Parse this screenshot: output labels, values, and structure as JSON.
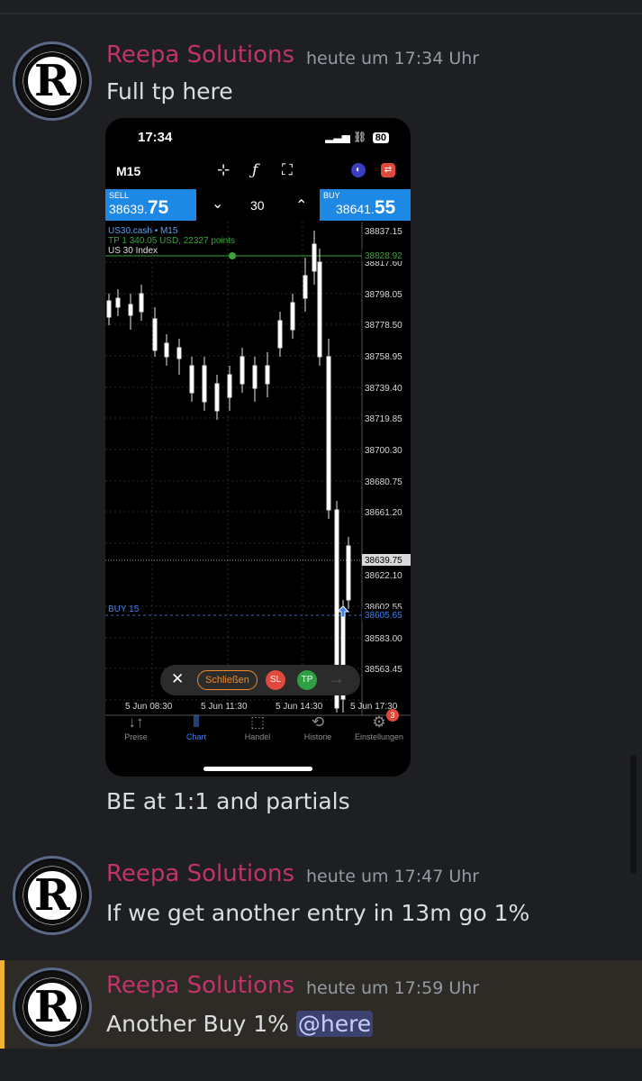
{
  "colors": {
    "author": "#c0336b",
    "mention_bg": "#3c4270",
    "accent_bar": "#f0b232",
    "bid_ask": "#1e88e5"
  },
  "messages": [
    {
      "author": "Reepa Solutions",
      "timestamp": "heute um 17:34 Uhr",
      "text": "Full tp here",
      "text_after_image": "BE at 1:1 and partials"
    },
    {
      "author": "Reepa Solutions",
      "timestamp": "heute um 17:47 Uhr",
      "text": "If we get another entry in 13m go 1%"
    },
    {
      "author": "Reepa Solutions",
      "timestamp": "heute um 17:59 Uhr",
      "text": "Another Buy 1% ",
      "mention": "@here"
    }
  ],
  "avatar": {
    "letter": "R"
  },
  "screenshot": {
    "status_time": "17:34",
    "battery": "80",
    "timeframe": "M15",
    "tools": [
      "crosshair-icon",
      "function-icon",
      "objects-icon"
    ],
    "sell": {
      "label": "SELL",
      "price_main": "38639.",
      "price_big": "75"
    },
    "buy": {
      "label": "BUY",
      "price_main": "38641.",
      "price_big": "55"
    },
    "lot": {
      "down": "⌄",
      "value": "30",
      "up": "⌃"
    },
    "symbol_line": "US30.cash • M15",
    "symbol_name": "US 30 Index",
    "tp_label": "TP 1 340.05 USD, 22327 points",
    "buy_line_label": "BUY 15",
    "price_labels": [
      "38837.15",
      "38817.60",
      "38798.05",
      "38778.50",
      "38758.95",
      "38739.40",
      "38719.85",
      "38700.30",
      "38680.75",
      "38661.20",
      "38622.10",
      "38602.55",
      "38583.00",
      "38563.45"
    ],
    "tp_price": "38828.92",
    "bid_price": "38639.75",
    "buy_price": "38605.65",
    "time_labels": [
      "5 Jun 08:30",
      "5 Jun 11:30",
      "5 Jun 14:30",
      "5 Jun 17:30"
    ],
    "bubble": {
      "close": "✕",
      "schliessen": "Schließen",
      "sl": "SL",
      "tp": "TP",
      "arrow": "→"
    },
    "tabs": [
      {
        "label": "Preise",
        "icon": "↓↑"
      },
      {
        "label": "Chart",
        "icon": "⫴"
      },
      {
        "label": "Handel",
        "icon": "⬚"
      },
      {
        "label": "Historie",
        "icon": "⟲"
      },
      {
        "label": "Einstellungen",
        "icon": "⚙",
        "badge": "3"
      }
    ]
  }
}
